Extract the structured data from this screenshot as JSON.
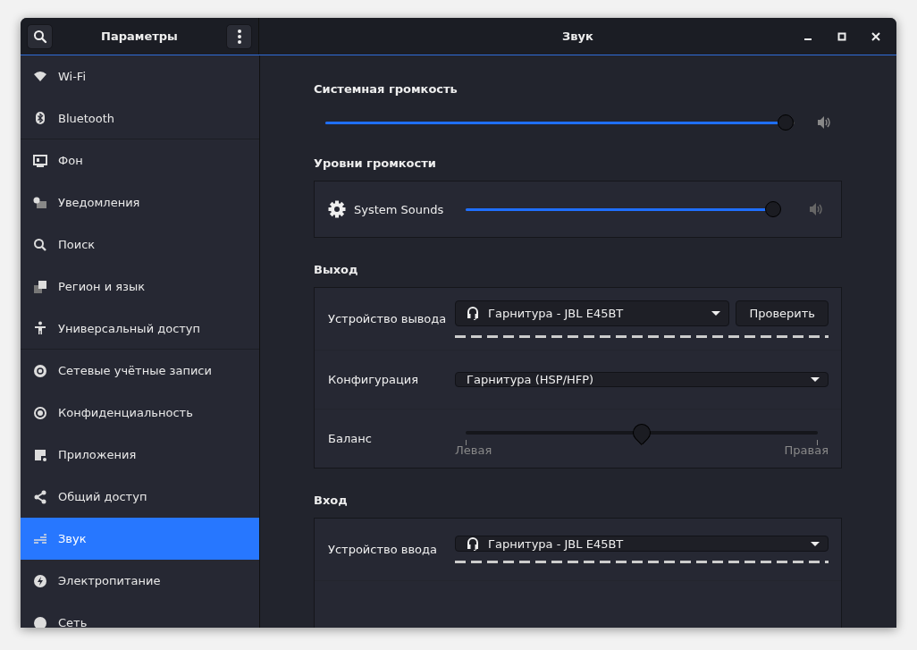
{
  "header": {
    "sidebar_title": "Параметры",
    "page_title": "Звук"
  },
  "sidebar": {
    "items": [
      {
        "label": "Wi-Fi",
        "selected": false,
        "separator_after": false
      },
      {
        "label": "Bluetooth",
        "selected": false,
        "separator_after": true
      },
      {
        "label": "Фон",
        "selected": false,
        "separator_after": false
      },
      {
        "label": "Уведомления",
        "selected": false,
        "separator_after": false
      },
      {
        "label": "Поиск",
        "selected": false,
        "separator_after": false
      },
      {
        "label": "Регион и язык",
        "selected": false,
        "separator_after": false
      },
      {
        "label": "Универсальный доступ",
        "selected": false,
        "separator_after": true
      },
      {
        "label": "Сетевые учётные записи",
        "selected": false,
        "separator_after": false
      },
      {
        "label": "Конфиденциальность",
        "selected": false,
        "separator_after": false
      },
      {
        "label": "Приложения",
        "selected": false,
        "separator_after": false
      },
      {
        "label": "Общий доступ",
        "selected": false,
        "separator_after": false
      },
      {
        "label": "Звук",
        "selected": true,
        "separator_after": false
      },
      {
        "label": "Электропитание",
        "selected": false,
        "separator_after": false
      },
      {
        "label": "Сеть",
        "selected": false,
        "separator_after": false
      }
    ]
  },
  "system_volume": {
    "heading": "Системная громкость",
    "level": 0.98
  },
  "volume_levels": {
    "heading": "Уровни громкости",
    "items": [
      {
        "name": "System Sounds",
        "level": 0.98
      }
    ]
  },
  "output": {
    "heading": "Выход",
    "device_label": "Устройство вывода",
    "device": "Гарнитура - JBL E45BT",
    "test_button": "Проверить",
    "meter": {
      "level": 0
    },
    "config_label": "Конфигурация",
    "config": "Гарнитура (HSP/HFP)",
    "balance_label": "Баланс",
    "balance": {
      "level": 0.5,
      "left": "Левая",
      "right": "Правая"
    }
  },
  "input": {
    "heading": "Вход",
    "device_label": "Устройство ввода",
    "device": "Гарнитура - JBL E45BT",
    "meter": {
      "level": 0
    }
  }
}
